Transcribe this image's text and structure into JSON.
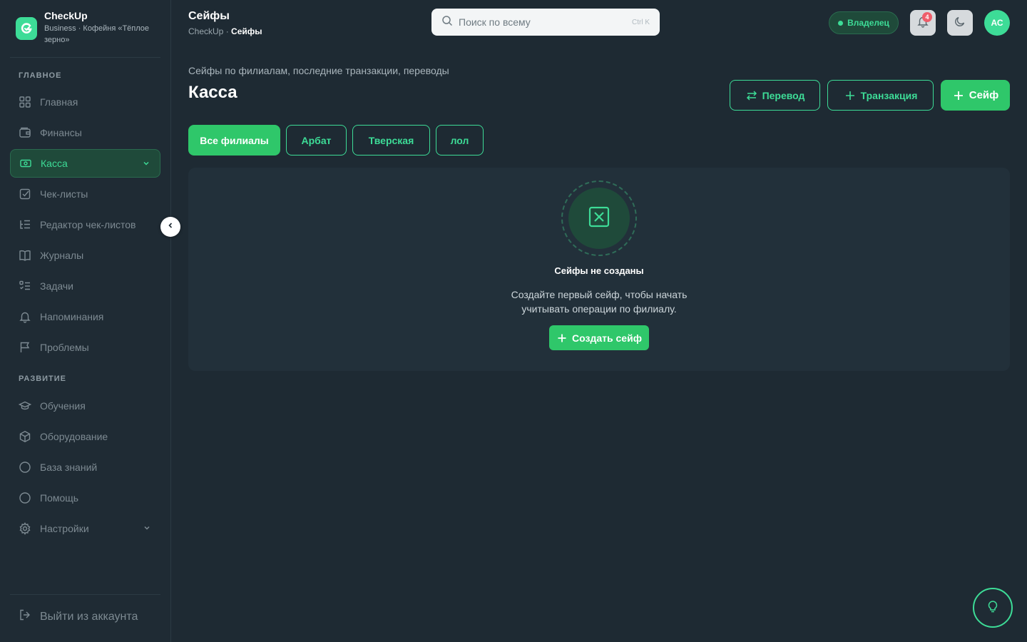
{
  "brand": {
    "name": "CheckUp",
    "subtitle": "Business · Кофейня «Тёплое зерно»"
  },
  "sidebar": {
    "sections": [
      {
        "title": "ГЛАВНОЕ"
      },
      {
        "title": "РАЗВИТИЕ"
      }
    ],
    "items": [
      {
        "label": "Главная",
        "icon": "grid-icon"
      },
      {
        "label": "Финансы",
        "icon": "wallet-icon"
      },
      {
        "label": "Касса",
        "icon": "cash-icon",
        "active": true
      },
      {
        "label": "Чек-листы",
        "icon": "checkbox-icon"
      },
      {
        "label": "Редактор чек-листов",
        "icon": "list-tree-icon"
      },
      {
        "label": "Журналы",
        "icon": "book-icon"
      },
      {
        "label": "Задачи",
        "icon": "tasks-icon"
      },
      {
        "label": "Напоминания",
        "icon": "bell-icon"
      },
      {
        "label": "Проблемы",
        "icon": "flag-icon"
      },
      {
        "label": "Обучения",
        "icon": "graduation-cap-icon"
      },
      {
        "label": "Оборудование",
        "icon": "box-icon"
      },
      {
        "label": "База знаний",
        "icon": "circle-icon"
      },
      {
        "label": "Помощь",
        "icon": "circle-icon"
      },
      {
        "label": "Настройки",
        "icon": "gear-icon"
      }
    ],
    "logout": "Выйти из аккаунта"
  },
  "header": {
    "title": "Сейфы",
    "breadcrumb_root": "CheckUp",
    "breadcrumb_sep": " · ",
    "breadcrumb_current": "Сейфы",
    "search_placeholder": "Поиск по всему",
    "search_shortcut": "Ctrl K",
    "role": "Владелец",
    "notifications": "4",
    "avatar": "АС"
  },
  "page": {
    "subtitle": "Сейфы по филиалам, последние транзакции, переводы",
    "title": "Касса",
    "actions": {
      "transfer": "Перевод",
      "transaction": "Транзакция",
      "safe": "Сейф"
    },
    "filters": [
      "Все филиалы",
      "Арбат",
      "Тверская",
      "лол"
    ],
    "empty": {
      "title": "Сейфы не созданы",
      "description": "Создайте первый сейф, чтобы начать учитывать операции по филиалу.",
      "button": "Создать сейф"
    }
  },
  "colors": {
    "accent": "#3ddc97",
    "primary": "#2fc76a",
    "background": "#1e2a33",
    "badge": "#ef5d6a"
  }
}
